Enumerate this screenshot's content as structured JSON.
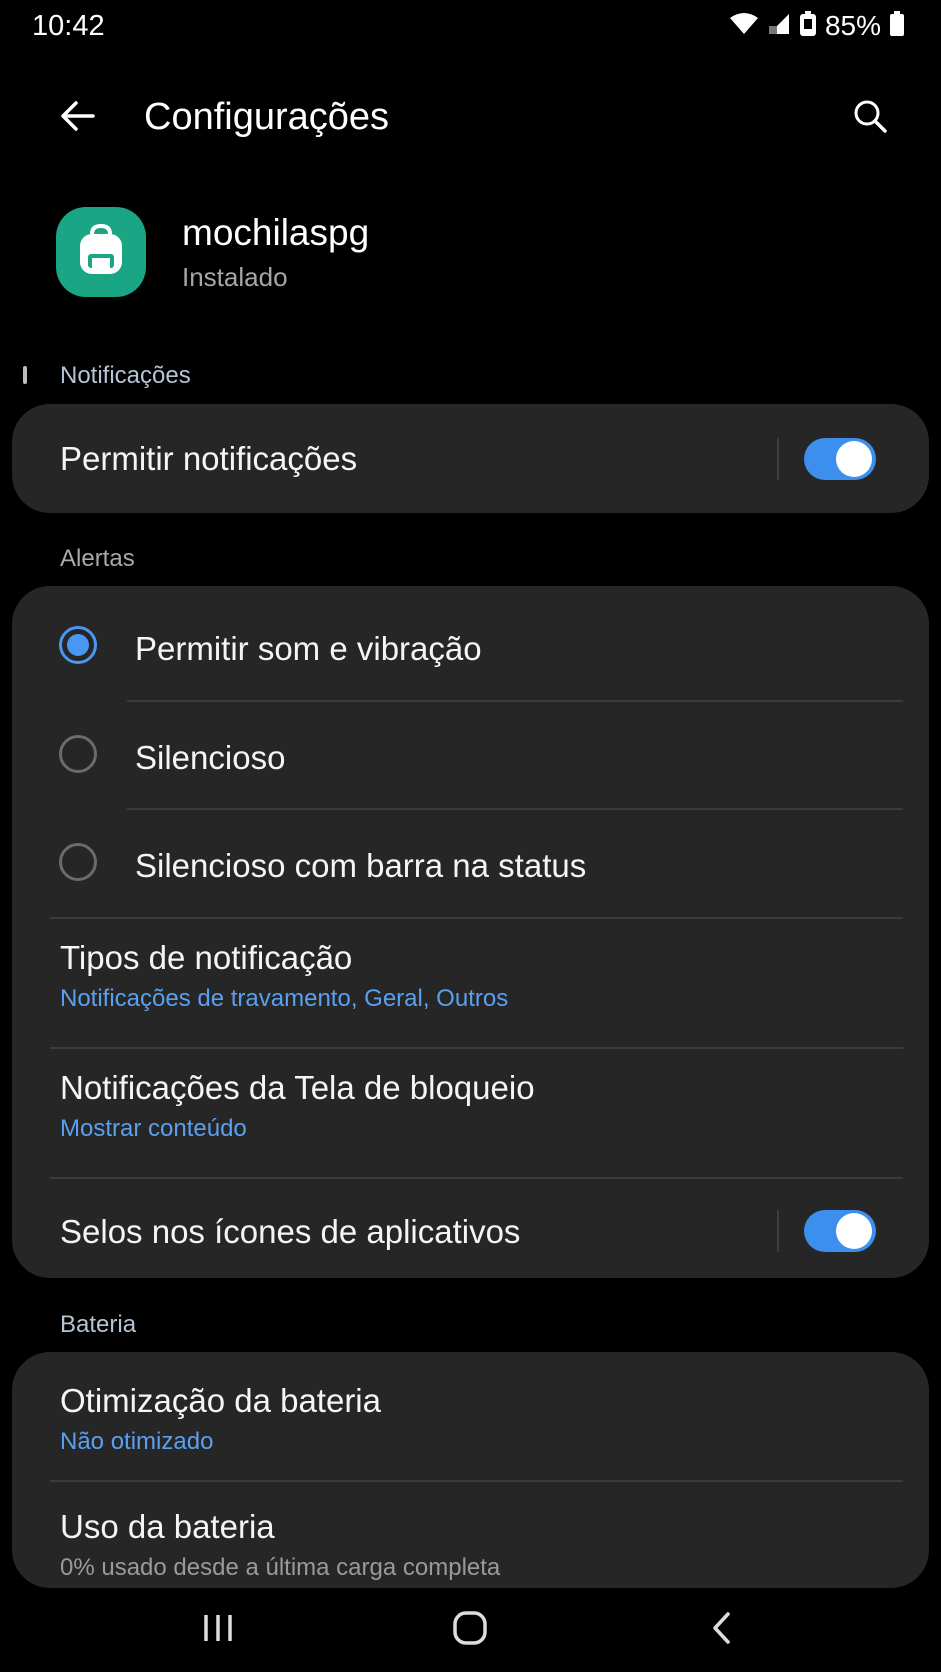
{
  "status_bar": {
    "time": "10:42",
    "battery": "85%"
  },
  "header": {
    "title": "Configurações"
  },
  "app": {
    "name": "mochilaspg",
    "status": "Instalado",
    "icon": "backpack-icon",
    "icon_color": "#1aa585"
  },
  "sections": {
    "notifications": "Notificações",
    "alerts": "Alertas",
    "battery": "Bateria"
  },
  "allow_notifications": {
    "label": "Permitir notificações",
    "enabled": true
  },
  "alert_options": [
    {
      "label": "Permitir som e vibração",
      "selected": true
    },
    {
      "label": "Silencioso",
      "selected": false
    },
    {
      "label": "Silencioso com barra na status",
      "selected": false
    }
  ],
  "notification_types": {
    "label": "Tipos de notificação",
    "value": "Notificações de travamento, Geral, Outros"
  },
  "lock_screen": {
    "label": "Notificações da Tela de bloqueio",
    "value": "Mostrar conteúdo"
  },
  "app_badges": {
    "label": "Selos nos ícones de aplicativos",
    "enabled": true
  },
  "battery_optimization": {
    "label": "Otimização da bateria",
    "value": "Não otimizado"
  },
  "battery_usage": {
    "label": "Uso da bateria",
    "value": "0% usado desde a última carga completa"
  },
  "colors": {
    "accent": "#3d8fee",
    "link": "#5aa0f0",
    "card": "#262626",
    "background": "#000000"
  }
}
